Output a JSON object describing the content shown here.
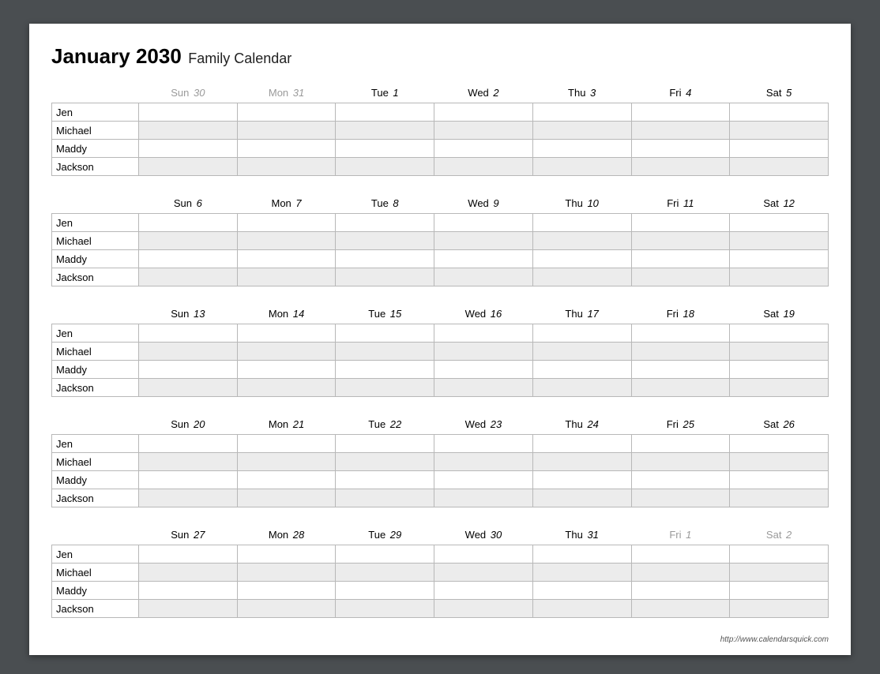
{
  "title": {
    "month": "January 2030",
    "subtitle": "Family Calendar"
  },
  "members": [
    "Jen",
    "Michael",
    "Maddy",
    "Jackson"
  ],
  "weeks": [
    {
      "days": [
        {
          "name": "Sun",
          "num": "30",
          "other": true
        },
        {
          "name": "Mon",
          "num": "31",
          "other": true
        },
        {
          "name": "Tue",
          "num": "1",
          "other": false
        },
        {
          "name": "Wed",
          "num": "2",
          "other": false
        },
        {
          "name": "Thu",
          "num": "3",
          "other": false
        },
        {
          "name": "Fri",
          "num": "4",
          "other": false
        },
        {
          "name": "Sat",
          "num": "5",
          "other": false
        }
      ]
    },
    {
      "days": [
        {
          "name": "Sun",
          "num": "6",
          "other": false
        },
        {
          "name": "Mon",
          "num": "7",
          "other": false
        },
        {
          "name": "Tue",
          "num": "8",
          "other": false
        },
        {
          "name": "Wed",
          "num": "9",
          "other": false
        },
        {
          "name": "Thu",
          "num": "10",
          "other": false
        },
        {
          "name": "Fri",
          "num": "11",
          "other": false
        },
        {
          "name": "Sat",
          "num": "12",
          "other": false
        }
      ]
    },
    {
      "days": [
        {
          "name": "Sun",
          "num": "13",
          "other": false
        },
        {
          "name": "Mon",
          "num": "14",
          "other": false
        },
        {
          "name": "Tue",
          "num": "15",
          "other": false
        },
        {
          "name": "Wed",
          "num": "16",
          "other": false
        },
        {
          "name": "Thu",
          "num": "17",
          "other": false
        },
        {
          "name": "Fri",
          "num": "18",
          "other": false
        },
        {
          "name": "Sat",
          "num": "19",
          "other": false
        }
      ]
    },
    {
      "days": [
        {
          "name": "Sun",
          "num": "20",
          "other": false
        },
        {
          "name": "Mon",
          "num": "21",
          "other": false
        },
        {
          "name": "Tue",
          "num": "22",
          "other": false
        },
        {
          "name": "Wed",
          "num": "23",
          "other": false
        },
        {
          "name": "Thu",
          "num": "24",
          "other": false
        },
        {
          "name": "Fri",
          "num": "25",
          "other": false
        },
        {
          "name": "Sat",
          "num": "26",
          "other": false
        }
      ]
    },
    {
      "days": [
        {
          "name": "Sun",
          "num": "27",
          "other": false
        },
        {
          "name": "Mon",
          "num": "28",
          "other": false
        },
        {
          "name": "Tue",
          "num": "29",
          "other": false
        },
        {
          "name": "Wed",
          "num": "30",
          "other": false
        },
        {
          "name": "Thu",
          "num": "31",
          "other": false
        },
        {
          "name": "Fri",
          "num": "1",
          "other": true
        },
        {
          "name": "Sat",
          "num": "2",
          "other": true
        }
      ]
    }
  ],
  "footer": "http://www.calendarsquick.com"
}
